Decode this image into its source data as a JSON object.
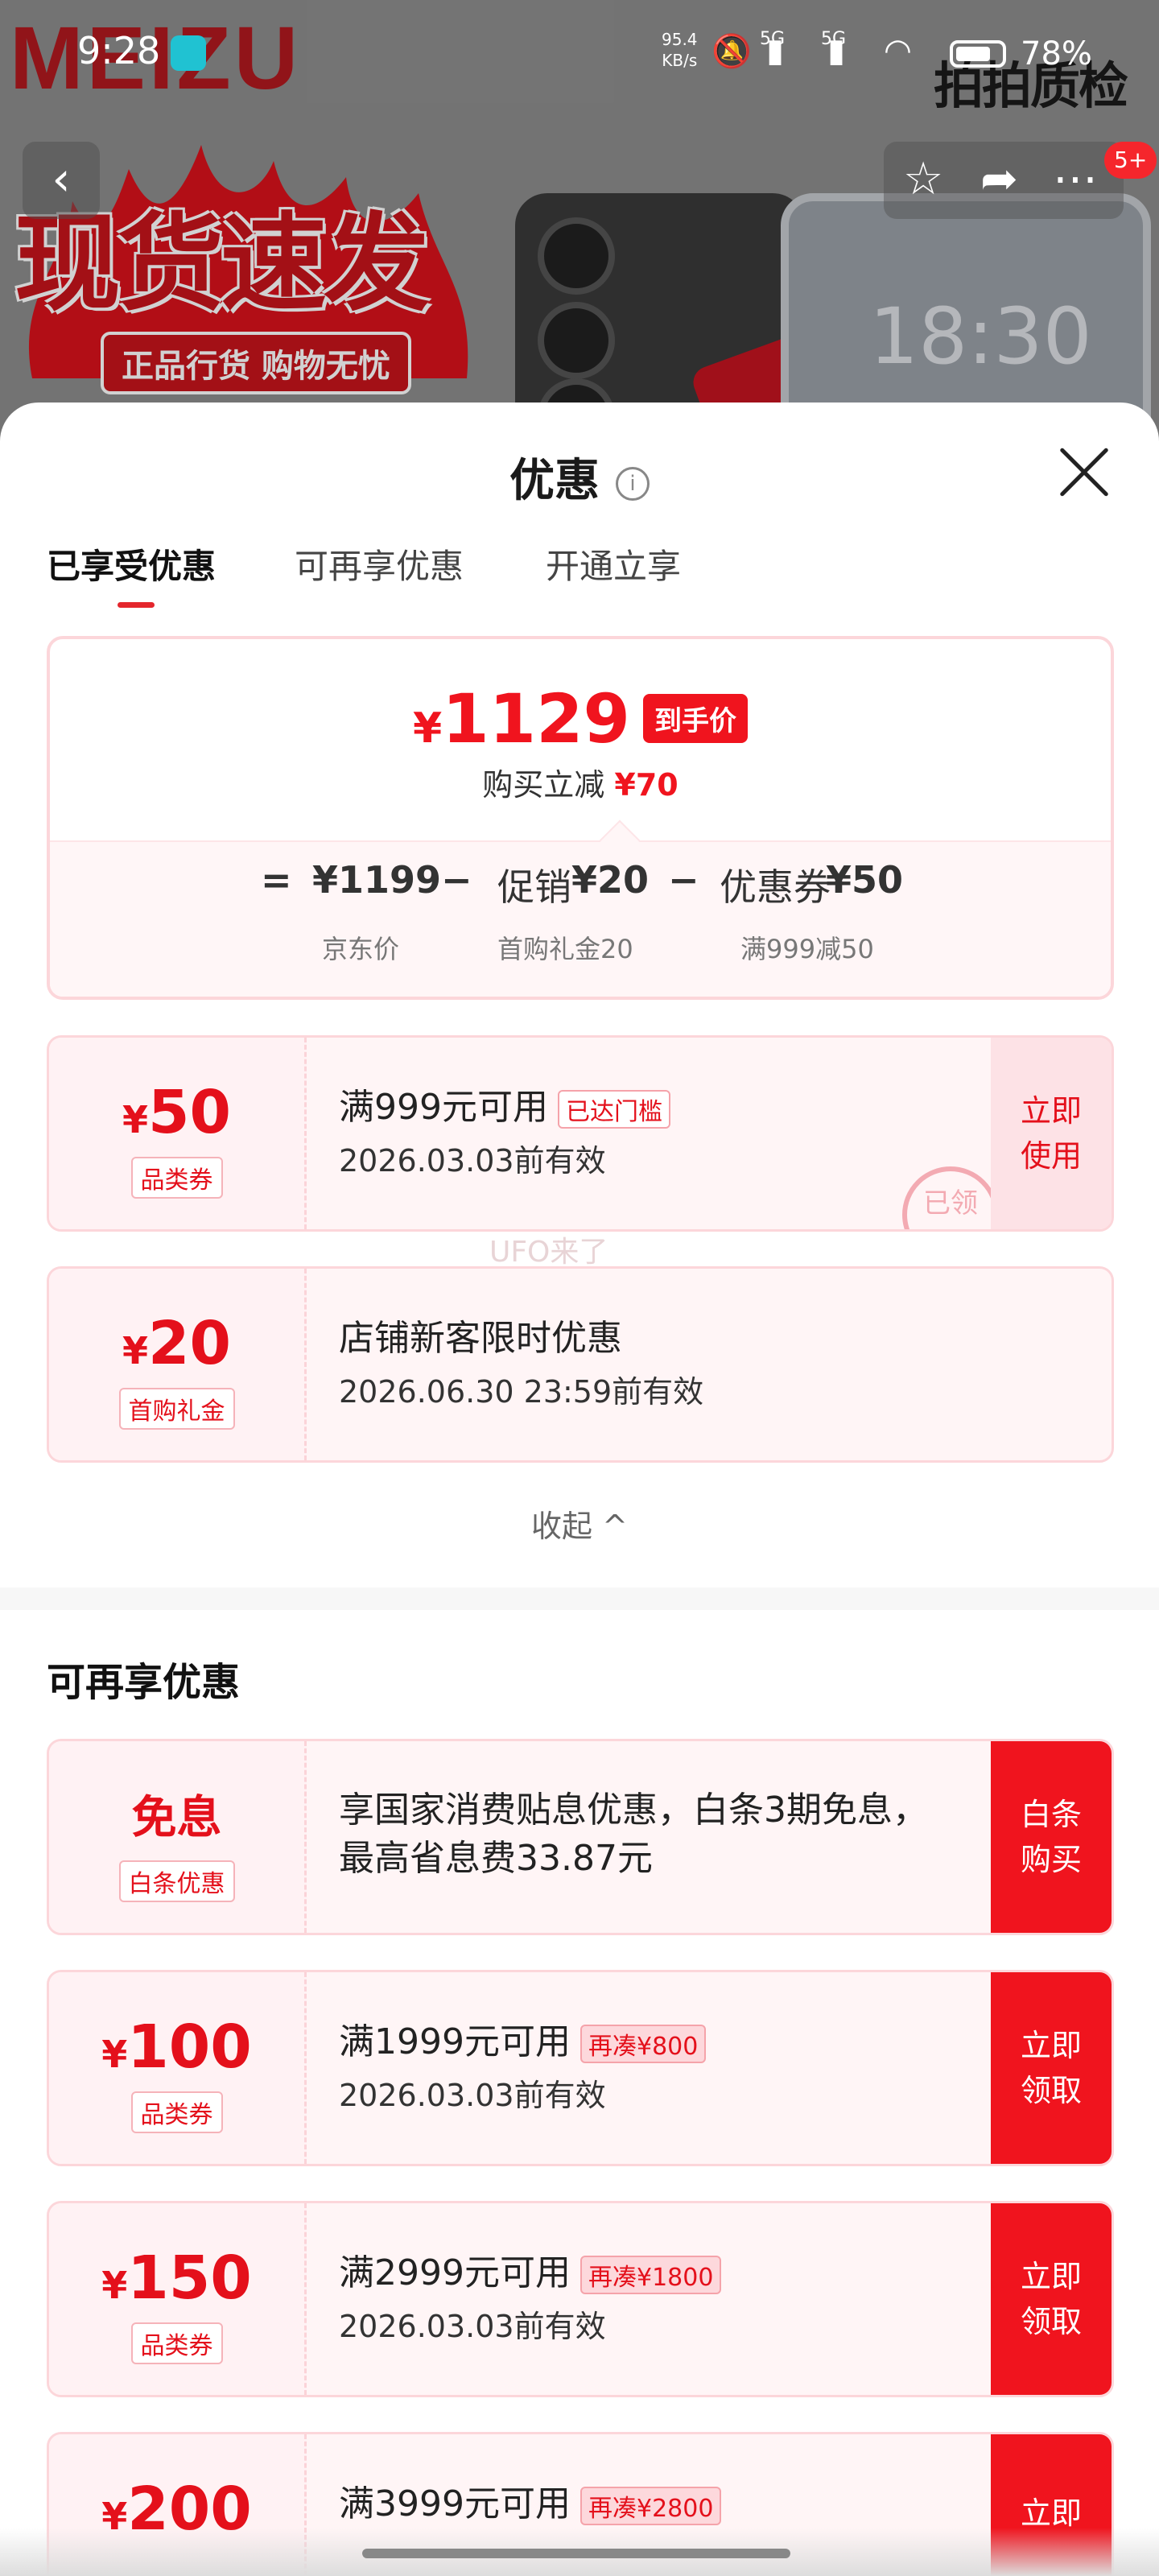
{
  "status_bar": {
    "time": "9:28",
    "net_speed_value": "95.4",
    "net_speed_unit": "KB/s",
    "signal1": "5G",
    "signal2": "5G",
    "battery": "78%"
  },
  "background": {
    "brand": "MEIZU",
    "watermark": "拍拍质检",
    "promo": "现货速发",
    "promo_sub": "正品行货 购物无忧",
    "clock": "18:30",
    "cart_badge": "5+"
  },
  "sheet": {
    "title": "优惠",
    "info_icon": "i",
    "tabs": [
      "已享受优惠",
      "可再享优惠",
      "开通立享"
    ],
    "active_tab": 0
  },
  "price_summary": {
    "currency": "¥",
    "final_price": "1129",
    "final_tag": "到手价",
    "instant_off_label": "购买立减",
    "instant_off_value": "¥70",
    "equals": "=",
    "base_price": "¥1199",
    "minus": "−",
    "promo_label": "促销",
    "promo_value": "¥20",
    "coupon_label": "优惠券",
    "coupon_value": "¥50",
    "base_caption": "京东价",
    "promo_caption": "首购礼金20",
    "coupon_caption": "满999减50"
  },
  "applied_coupons": [
    {
      "currency": "¥",
      "amount": "50",
      "type": "品类券",
      "title": "满999元可用",
      "badge": "已达门槛",
      "validity": "2026.03.03前有效",
      "action": "立即\n使用",
      "stamp": "已领"
    },
    {
      "currency": "¥",
      "amount": "20",
      "type": "首购礼金",
      "title": "店铺新客限时优惠",
      "validity": "2026.06.30 23:59前有效"
    }
  ],
  "watermark_text": "UFO来了",
  "collapse_label": "收起 ^",
  "more_section": {
    "title": "可再享优惠",
    "items": [
      {
        "amount_text": "免息",
        "type": "白条优惠",
        "description": "享国家消费贴息优惠，白条3期免息，最高省息费33.87元",
        "action": "白条\n购买"
      },
      {
        "currency": "¥",
        "amount": "100",
        "type": "品类券",
        "title": "满1999元可用",
        "badge": "再凑¥800",
        "validity": "2026.03.03前有效",
        "action": "立即\n领取"
      },
      {
        "currency": "¥",
        "amount": "150",
        "type": "品类券",
        "title": "满2999元可用",
        "badge": "再凑¥1800",
        "validity": "2026.03.03前有效",
        "action": "立即\n领取"
      },
      {
        "currency": "¥",
        "amount": "200",
        "title": "满3999元可用",
        "badge": "再凑¥2800",
        "action": "立即"
      }
    ]
  },
  "colors": {
    "accent_red": "#f0141e",
    "card_border": "#fcd6da",
    "card_bg": "#fff5f6"
  }
}
